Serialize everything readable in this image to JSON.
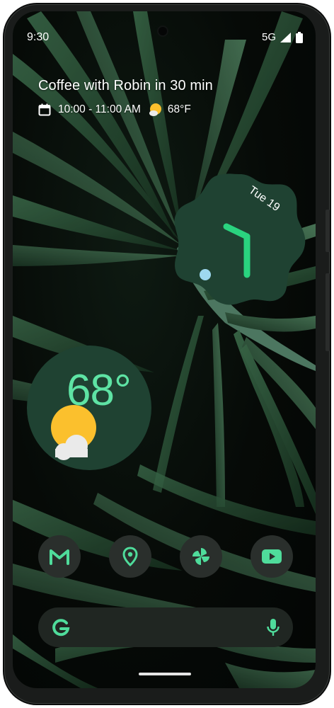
{
  "status_bar": {
    "time": "9:30",
    "network": "5G",
    "signal_icon": "signal-full-icon",
    "battery_icon": "battery-full-icon"
  },
  "at_a_glance": {
    "event_title": "Coffee with Robin in 30 min",
    "event_icon": "calendar-icon",
    "event_time": "10:00 - 11:00 AM",
    "weather_icon": "partly-sunny-icon",
    "weather_temp": "68°F"
  },
  "clock_widget": {
    "date": "Tue 19",
    "time_shown": "9:30",
    "colors": {
      "face": "#1f4232",
      "hour_hand": "#2ad37f",
      "minute_hand": "#2ad37f",
      "second_dot": "#9ed8ef"
    }
  },
  "weather_widget": {
    "temp": "68°",
    "icon": "sun-behind-cloud-icon",
    "colors": {
      "background": "#1f4232",
      "temp_text": "#5ee3a4",
      "sun": "#fbc02d",
      "cloud": "#eaeaea"
    }
  },
  "dock": {
    "apps": [
      {
        "name": "Gmail",
        "icon": "gmail-icon"
      },
      {
        "name": "Maps",
        "icon": "maps-pin-icon"
      },
      {
        "name": "Photos",
        "icon": "pinwheel-icon"
      },
      {
        "name": "YouTube",
        "icon": "youtube-icon"
      }
    ],
    "icon_color": "#4fdc9b"
  },
  "search_bar": {
    "logo_icon": "google-g-icon",
    "mic_icon": "microphone-icon",
    "accent": "#4fdc9b"
  }
}
